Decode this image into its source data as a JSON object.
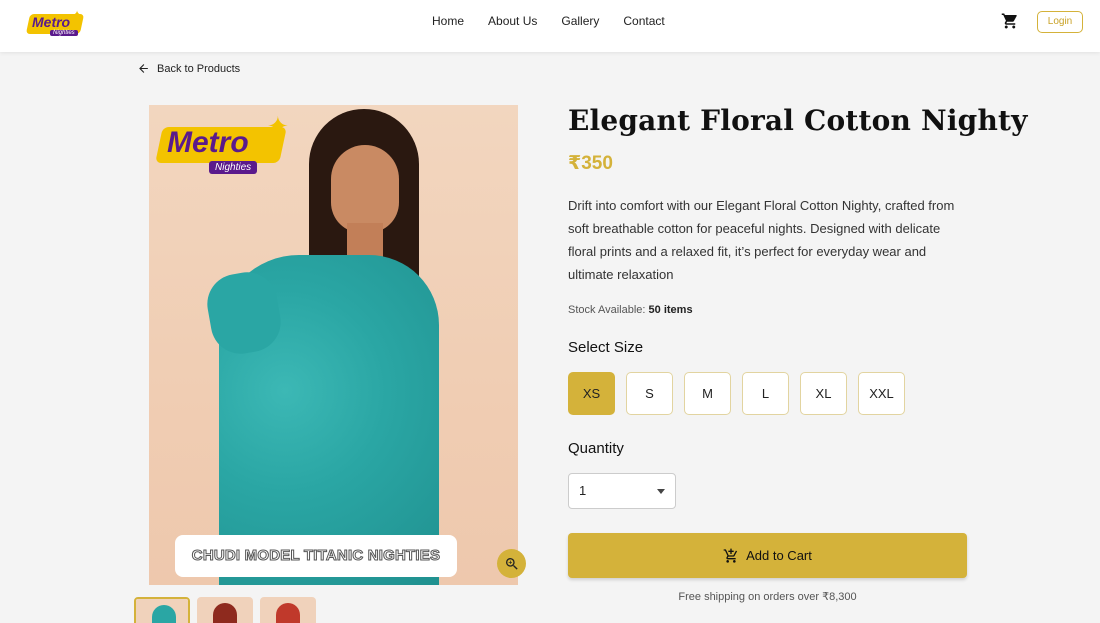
{
  "brand": {
    "name": "Metro",
    "tagline": "Nighties"
  },
  "nav": {
    "items": [
      "Home",
      "About Us",
      "Gallery",
      "Contact"
    ]
  },
  "header": {
    "login_label": "Login"
  },
  "back_label": "Back to Products",
  "image": {
    "caption": "CHUDI MODEL TITANIC NIGHTIES"
  },
  "product": {
    "title": "Elegant Floral Cotton Nighty",
    "price": "₹350",
    "description": "Drift into comfort with our Elegant Floral Cotton Nighty, crafted from soft breathable cotton for peaceful nights. Designed with delicate floral prints and a relaxed fit, it’s perfect for everyday wear and ultimate relaxation",
    "stock_label": "Stock Available:",
    "stock_value": "50 items"
  },
  "size": {
    "label": "Select Size",
    "options": [
      "XS",
      "S",
      "M",
      "L",
      "XL",
      "XXL"
    ],
    "selected": "XS"
  },
  "quantity": {
    "label": "Quantity",
    "value": "1"
  },
  "cart_button": {
    "label": "Add to Cart"
  },
  "shipping_note": "Free shipping on orders over ₹8,300",
  "colors": {
    "accent": "#d4b23a",
    "brand_purple": "#5a1a8c",
    "dress": "#2aa6a4"
  }
}
